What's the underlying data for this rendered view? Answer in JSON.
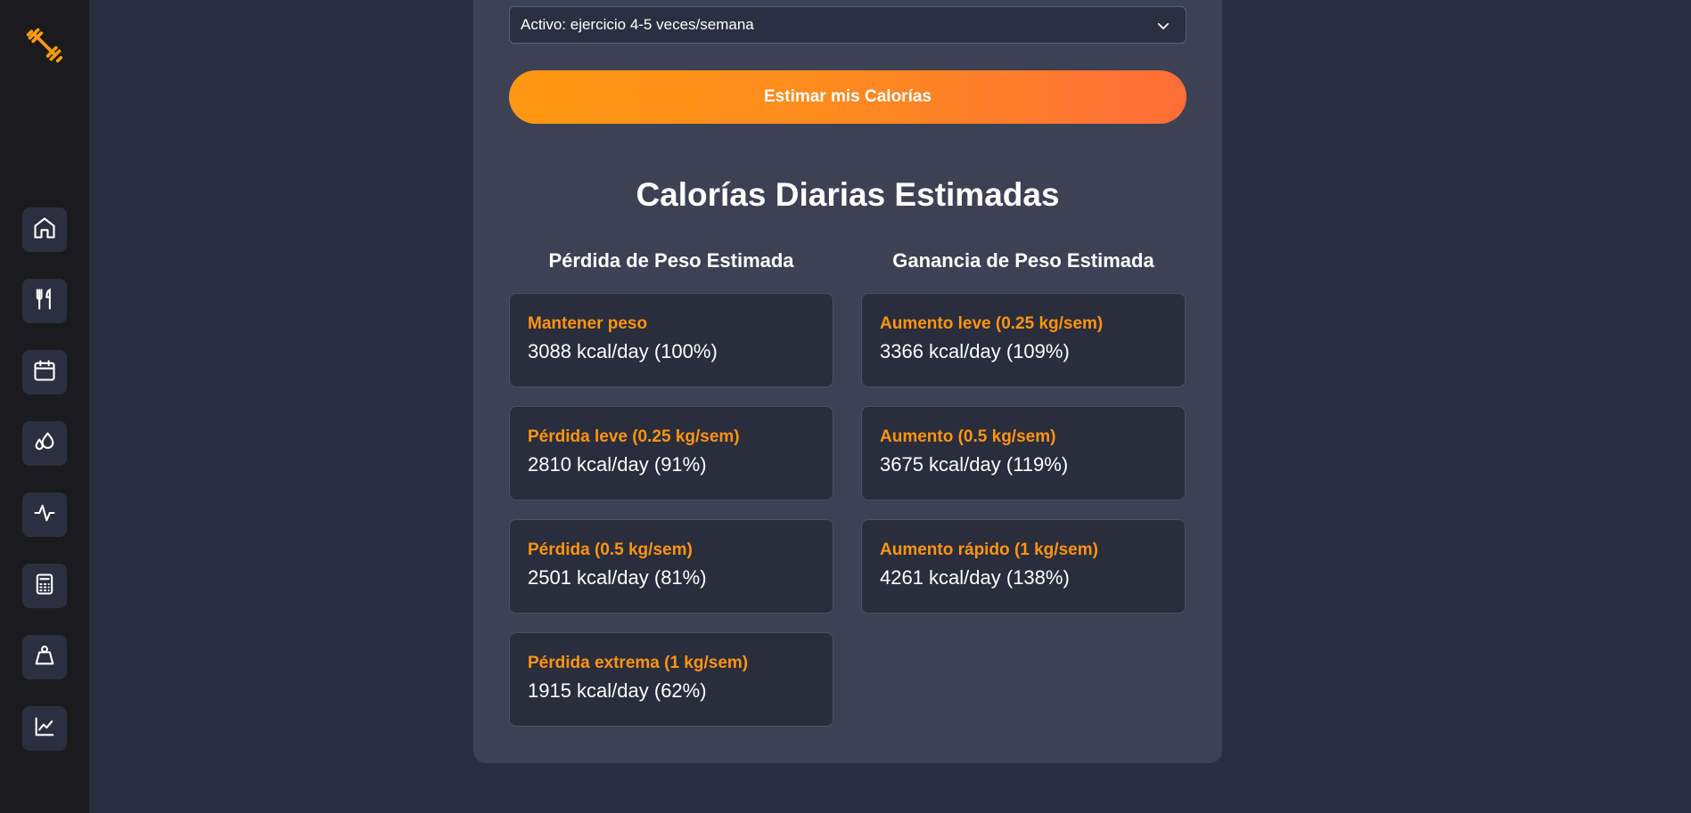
{
  "sidebar": {
    "logo_icon": "dumbbell-icon",
    "items": [
      {
        "name": "home-icon"
      },
      {
        "name": "utensils-icon"
      },
      {
        "name": "calendar-icon"
      },
      {
        "name": "droplets-icon"
      },
      {
        "name": "activity-icon"
      },
      {
        "name": "calculator-icon"
      },
      {
        "name": "weight-icon"
      },
      {
        "name": "chart-line-icon"
      }
    ]
  },
  "form": {
    "activity_select_value": "Activo: ejercicio 4-5 veces/semana",
    "estimate_button_label": "Estimar mis Calorías"
  },
  "results": {
    "title": "Calorías Diarias Estimadas",
    "loss": {
      "title": "Pérdida de Peso Estimada",
      "items": [
        {
          "label": "Mantener peso",
          "value": "3088 kcal/day (100%)"
        },
        {
          "label": "Pérdida leve (0.25 kg/sem)",
          "value": "2810 kcal/day (91%)"
        },
        {
          "label": "Pérdida (0.5 kg/sem)",
          "value": "2501 kcal/day (81%)"
        },
        {
          "label": "Pérdida extrema (1 kg/sem)",
          "value": "1915 kcal/day (62%)"
        }
      ]
    },
    "gain": {
      "title": "Ganancia de Peso Estimada",
      "items": [
        {
          "label": "Aumento leve (0.25 kg/sem)",
          "value": "3366 kcal/day (109%)"
        },
        {
          "label": "Aumento (0.5 kg/sem)",
          "value": "3675 kcal/day (119%)"
        },
        {
          "label": "Aumento rápido (1 kg/sem)",
          "value": "4261 kcal/day (138%)"
        }
      ]
    }
  },
  "colors": {
    "accent": "#ff9410",
    "background": "#2a2f40",
    "panel": "#3c4253",
    "card": "#2a2d3c",
    "sidebar": "#1b1b1d"
  }
}
